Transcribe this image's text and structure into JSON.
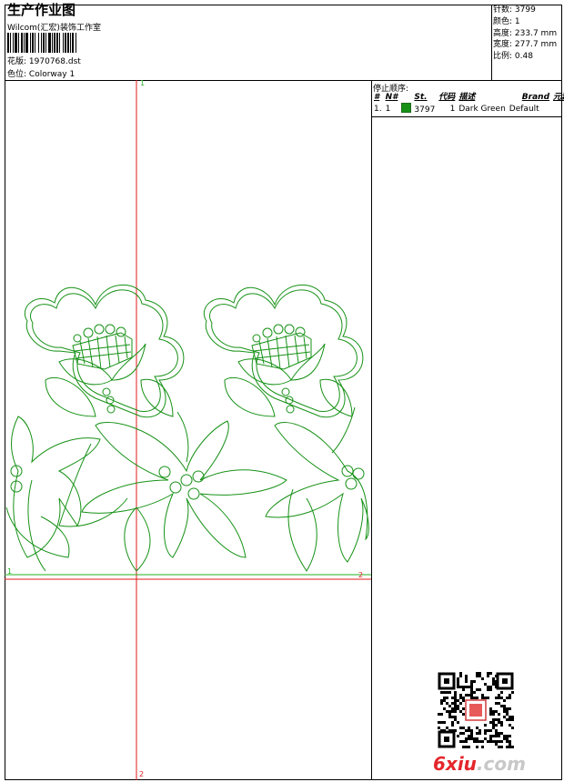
{
  "header": {
    "title": "生产作业图",
    "studio": "Wilcom(汇宏)装饰工作室",
    "design_label": "花版:",
    "design_value": "1970768.dst",
    "colorway_label": "色位:",
    "colorway_value": "Colorway 1"
  },
  "stats": [
    {
      "label": "针数:",
      "value": "3799"
    },
    {
      "label": "颜色:",
      "value": "1"
    },
    {
      "label": "高度:",
      "value": "233.7 mm"
    },
    {
      "label": "宽度:",
      "value": "277.7 mm"
    },
    {
      "label": "比例:",
      "value": "0.48"
    }
  ],
  "stop_sequence": {
    "label": "停止顺序:",
    "columns": [
      "#",
      "N#",
      "St.",
      "代码",
      "描述",
      "Brand",
      "元素"
    ],
    "rows": [
      {
        "no": "1.",
        "needle": "1",
        "swatch_color": "#169116",
        "stitches": "3797",
        "code": "1",
        "description": "Dark Green",
        "brand": "Default",
        "element": ""
      }
    ]
  },
  "axes": {
    "v_top": "1",
    "v_bottom": "2",
    "h_left": "1",
    "h_right": "2"
  },
  "colors": {
    "stitch": "#169116",
    "guide_red": "#e01b1b",
    "guide_green": "#22b022"
  },
  "watermark": {
    "logo_a": "6xiu",
    "logo_b": ".com"
  }
}
